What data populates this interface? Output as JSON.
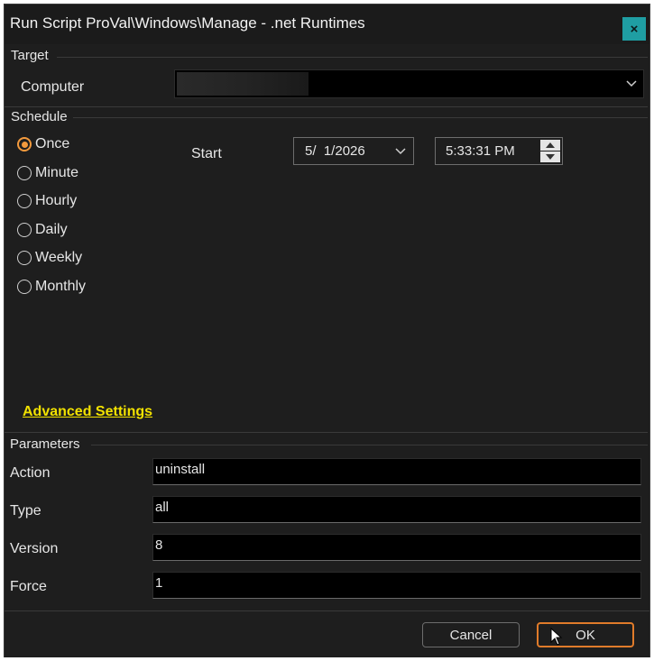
{
  "window": {
    "title": "Run Script ProVal\\Windows\\Manage - .net Runtimes",
    "close_glyph": "×"
  },
  "target": {
    "section_label": "Target",
    "computer_label": "Computer",
    "computer_value": ""
  },
  "schedule": {
    "section_label": "Schedule",
    "options": [
      {
        "label": "Once",
        "checked": true
      },
      {
        "label": "Minute",
        "checked": false
      },
      {
        "label": "Hourly",
        "checked": false
      },
      {
        "label": "Daily",
        "checked": false
      },
      {
        "label": "Weekly",
        "checked": false
      },
      {
        "label": "Monthly",
        "checked": false
      }
    ],
    "start_label": "Start",
    "date_value": "5/  1/2026",
    "time_value": "5:33:31 PM",
    "advanced_link": "Advanced Settings"
  },
  "parameters": {
    "section_label": "Parameters",
    "rows": [
      {
        "label": "Action",
        "value": "uninstall"
      },
      {
        "label": "Type",
        "value": "all"
      },
      {
        "label": "Version",
        "value": "8"
      },
      {
        "label": "Force",
        "value": "1"
      }
    ]
  },
  "footer": {
    "cancel_label": "Cancel",
    "ok_label": "OK"
  },
  "colors": {
    "accent_orange": "#e07b2a",
    "link_yellow": "#f2e200",
    "close_teal": "#1f9ea3",
    "background": "#1e1e1e"
  }
}
